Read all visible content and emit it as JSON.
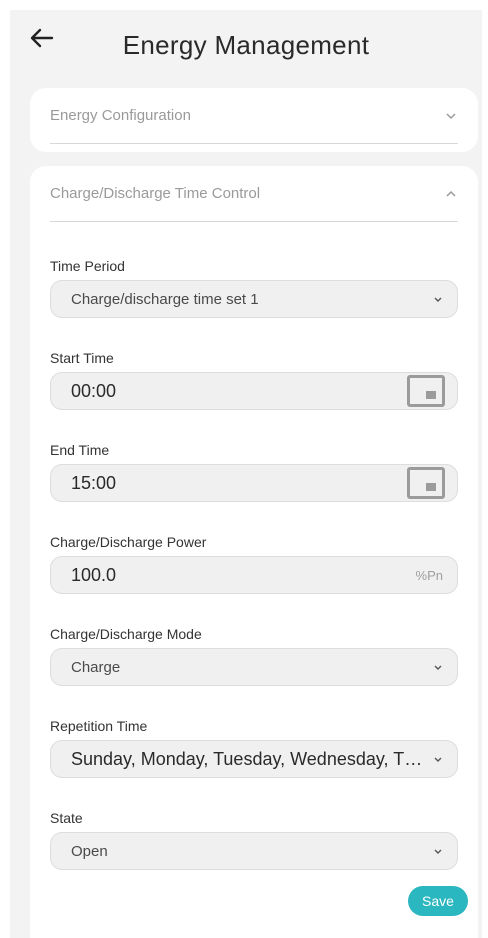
{
  "header": {
    "title": "Energy Management",
    "back_icon": "arrow-left-icon"
  },
  "energy_configuration": {
    "label": "Energy Configuration",
    "expanded": false
  },
  "time_control": {
    "label": "Charge/Discharge Time Control",
    "expanded": true
  },
  "form": {
    "time_period": {
      "label": "Time Period",
      "value": "Charge/discharge time set 1"
    },
    "start_time": {
      "label": "Start Time",
      "value": "00:00",
      "icon": "calendar-icon"
    },
    "end_time": {
      "label": "End Time",
      "value": "15:00",
      "icon": "calendar-icon"
    },
    "power": {
      "label": "Charge/Discharge Power",
      "value": "100.0",
      "unit": "%Pn"
    },
    "mode": {
      "label": "Charge/Discharge Mode",
      "value": "Charge"
    },
    "repetition": {
      "label": "Repetition Time",
      "value": "Sunday, Monday, Tuesday, Wednesday, Thursday, Friday, Saturday"
    },
    "state": {
      "label": "State",
      "value": "Open"
    }
  },
  "actions": {
    "save_label": "Save"
  },
  "colors": {
    "accent": "#2bb7c0",
    "background": "#f3f3f3",
    "card": "#ffffff"
  }
}
